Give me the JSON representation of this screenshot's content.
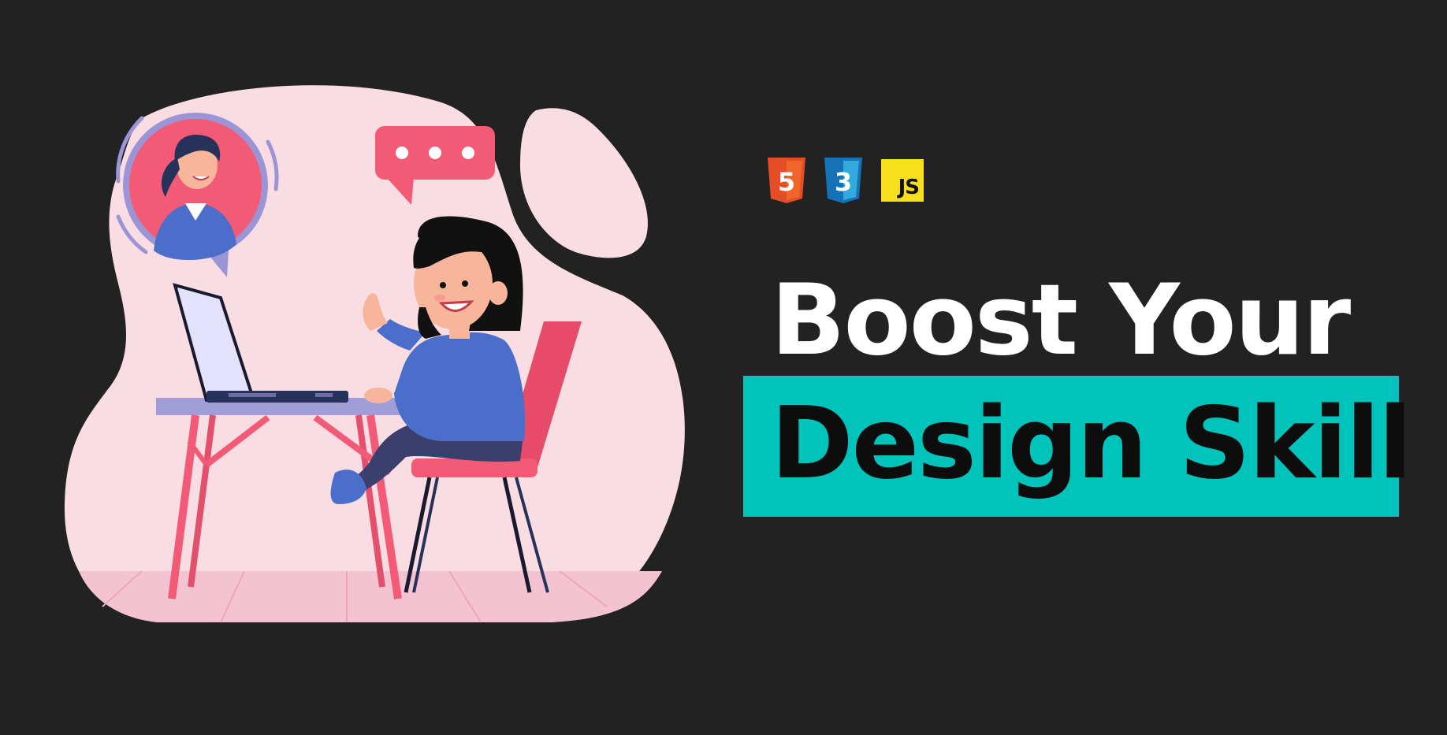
{
  "headline": {
    "line1": "Boost Your",
    "line2": "Design Skill"
  },
  "tech_logos": {
    "html": "5",
    "css": "3",
    "js": "JS"
  },
  "chat_bubble": {
    "dots": "• • •"
  },
  "icons": [
    "html5-logo-icon",
    "css3-logo-icon",
    "javascript-logo-icon",
    "chat-bubble-icon"
  ],
  "colors": {
    "background": "#222222",
    "blob": "#fadde3",
    "accent_pink": "#f25a76",
    "accent_teal": "#00c4bb",
    "shirt_blue": "#4a6ec9",
    "html_orange": "#e44d26",
    "css_blue": "#1572b6",
    "js_yellow": "#f7df1e"
  }
}
